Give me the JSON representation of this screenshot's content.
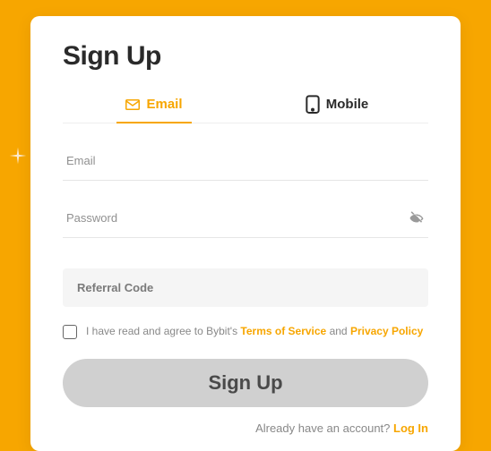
{
  "title": "Sign Up",
  "tabs": {
    "email": "Email",
    "mobile": "Mobile"
  },
  "fields": {
    "email": "Email",
    "password": "Password",
    "referral": "Referral Code"
  },
  "agree": {
    "prefix": "I have read and agree to Bybit's ",
    "tos": "Terms of Service",
    "mid": " and ",
    "privacy": "Privacy Policy"
  },
  "button": "Sign Up",
  "login": {
    "prefix": "Already have an account? ",
    "link": "Log In"
  }
}
